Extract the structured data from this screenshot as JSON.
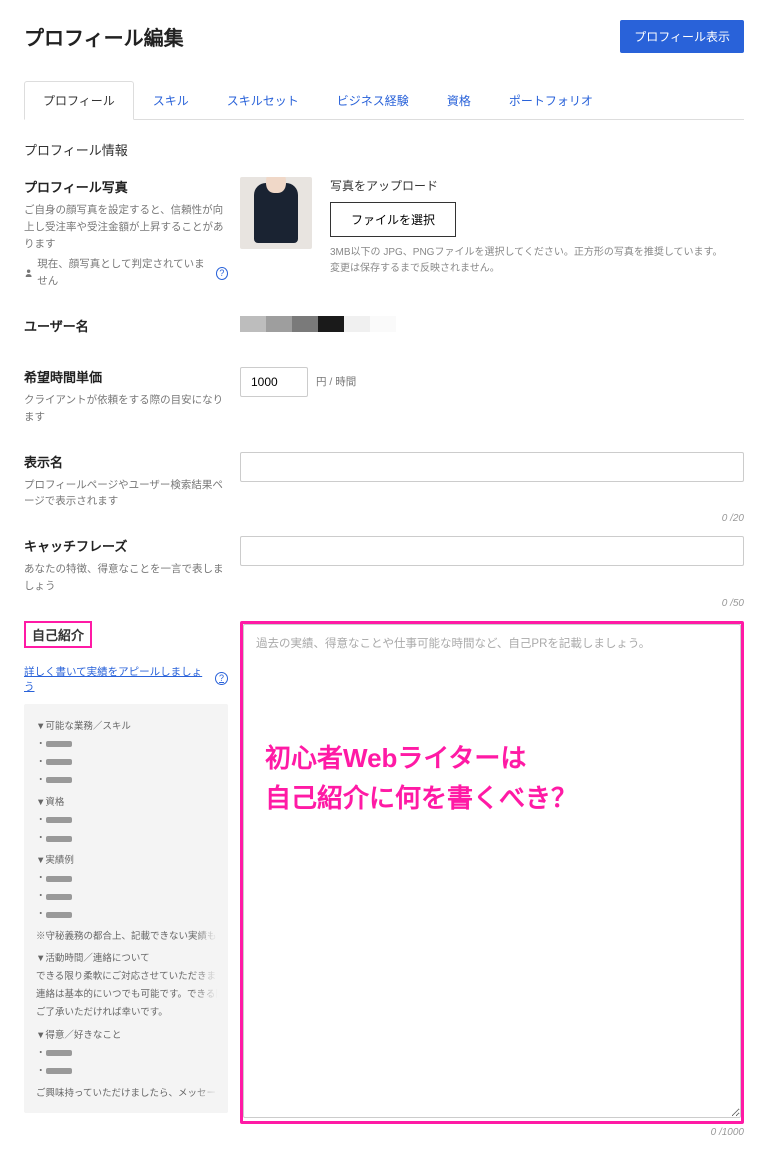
{
  "header": {
    "title": "プロフィール編集",
    "view_button": "プロフィール表示"
  },
  "tabs": [
    {
      "label": "プロフィール",
      "active": true
    },
    {
      "label": "スキル",
      "active": false
    },
    {
      "label": "スキルセット",
      "active": false
    },
    {
      "label": "ビジネス経験",
      "active": false
    },
    {
      "label": "資格",
      "active": false
    },
    {
      "label": "ポートフォリオ",
      "active": false
    }
  ],
  "section_title": "プロフィール情報",
  "fields": {
    "photo": {
      "label": "プロフィール写真",
      "desc": "ご自身の顔写真を設定すると、信頼性が向上し受注率や受注金額が上昇することがあります",
      "meta": "現在、顔写真として判定されていません",
      "upload_title": "写真をアップロード",
      "select_button": "ファイルを選択",
      "hint1": "3MB以下の JPG、PNGファイルを選択してください。正方形の写真を推奨しています。",
      "hint2": "変更は保存するまで反映されません。"
    },
    "username": {
      "label": "ユーザー名"
    },
    "rate": {
      "label": "希望時間単価",
      "desc": "クライアントが依頼をする際の目安になります",
      "value": "1000",
      "unit": "円 / 時間"
    },
    "display_name": {
      "label": "表示名",
      "desc": "プロフィールページやユーザー検索結果ページで表示されます",
      "counter": "0 /20"
    },
    "tagline": {
      "label": "キャッチフレーズ",
      "desc": "あなたの特徴、得意なことを一言で表しましょう",
      "counter": "0 /50"
    },
    "intro": {
      "label": "自己紹介",
      "help": "詳しく書いて実績をアピールしましょう",
      "placeholder": "過去の実績、得意なことや仕事可能な時間など、自己PRを記載しましょう。",
      "counter": "0 /1000",
      "example": {
        "h1": "▼可能な業務／スキル",
        "h2": "▼資格",
        "h3": "▼実績例",
        "note": "※守秘義務の都合上、記載できない実績もございます。個別にはお話できるものもございますので、ご興味を持っていただけましたら",
        "h4": "▼活動時間／連絡について",
        "note2a": "できる限り柔軟にご対応させていただきます。急ぎの案件等もお気軽",
        "note2b": "連絡は基本的にいつでも可能です。できる限り素早い返信を心がけま",
        "note2c": "ご了承いただければ幸いです。",
        "h5": "▼得意／好きなこと",
        "closing": "ご興味持っていただけましたら、メッセージでお気軽にお声がけくだ どうぞよろしくお願いいたします！"
      }
    }
  },
  "overlay": {
    "line1": "初心者Webライターは",
    "line2": "自己紹介に何を書くべき？"
  }
}
